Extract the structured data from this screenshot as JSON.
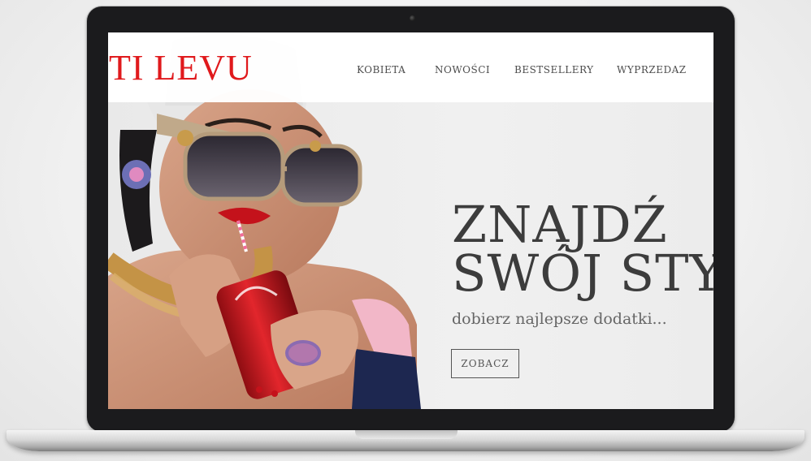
{
  "brand": {
    "logo_text": "TI LEVU",
    "logo_color": "#e0191c"
  },
  "nav": {
    "items": [
      {
        "label": "KOBIETA"
      },
      {
        "label": "NOWOŚCI"
      },
      {
        "label": "BESTSELLERY"
      },
      {
        "label": "WYPRZEDAZ"
      }
    ]
  },
  "hero": {
    "title_line1": "ZNAJDŹ",
    "title_line2": "SWÓJ STYL",
    "subtitle": "dobierz najlepsze dodatki...",
    "cta_label": "ZOBACZ"
  },
  "colors": {
    "text_dark": "#3c3c3c",
    "nav_text": "#4c4c4c",
    "accent_red": "#e0191c"
  }
}
